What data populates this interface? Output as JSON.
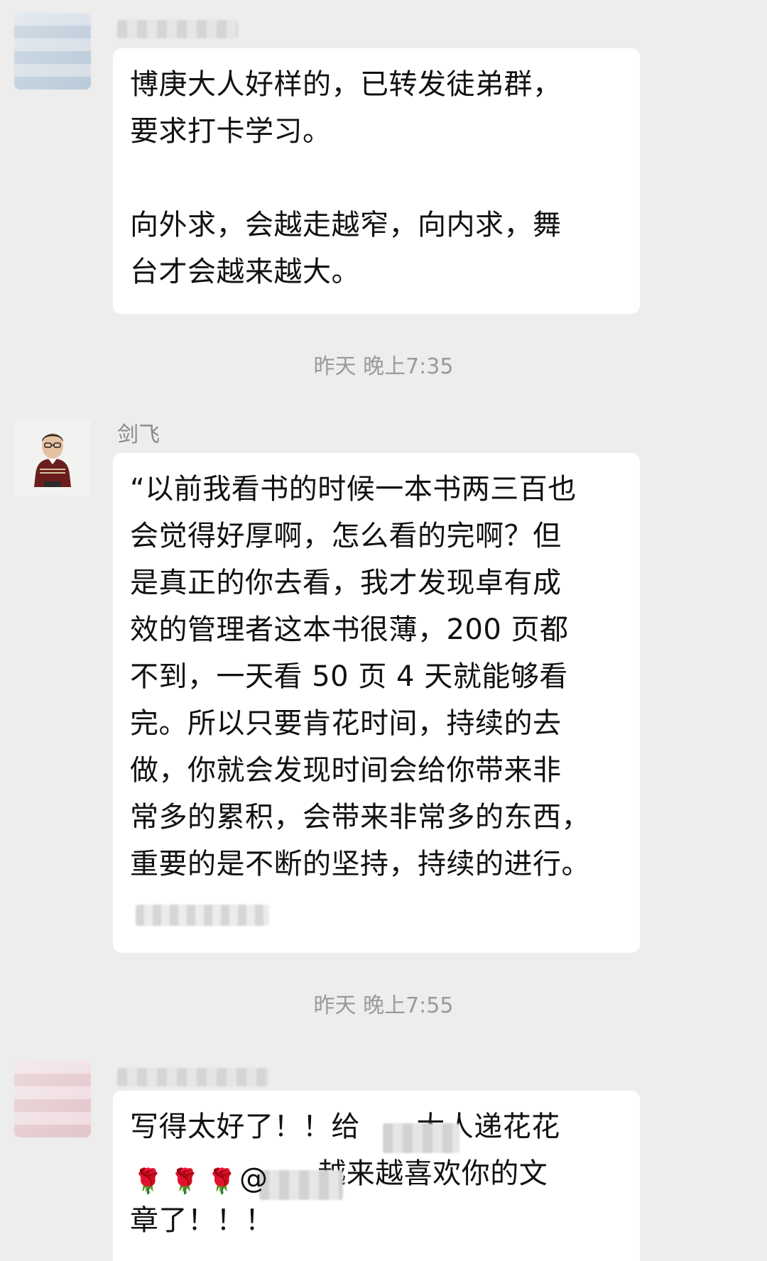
{
  "messages": [
    {
      "id": "m1",
      "text": "博庚大人好样的，已转发徒弟群，\n要求打卡学习。\n\n向外求，会越走越窄，向内求，舞\n台才会越来越大。"
    },
    {
      "id": "m2",
      "sender": "剑飞",
      "text": "“以前我看书的时候一本书两三百也\n会觉得好厚啊，怎么看的完啊？但\n是真正的你去看，我才发现卓有成\n效的管理者这本书很薄，200 页都\n不到，一天看 50 页 4 天就能够看\n完。所以只要肯花时间，持续的去\n做，你就会发现时间会给你带来非\n常多的累积，会带来非常多的东西，\n重要的是不断的坚持，持续的进行。"
    },
    {
      "id": "m3",
      "text": "写得太好了！！给      大人递花花\n                    越来越喜欢你的文\n章了！！！",
      "mention_symbol": "@"
    }
  ],
  "timestamps": {
    "t1": "昨天 晚上7:35",
    "t2": "昨天 晚上7:55"
  },
  "icons": {
    "avatar_1": "blurred-avatar-icon",
    "avatar_2": "person-photo-avatar",
    "avatar_3": "blurred-avatar-icon",
    "rose": "rose-emoji"
  },
  "colors": {
    "background": "#ededed",
    "bubble": "#ffffff",
    "text": "#111111",
    "timestamp": "#9a9a9a",
    "sender": "#8a8a8a"
  }
}
